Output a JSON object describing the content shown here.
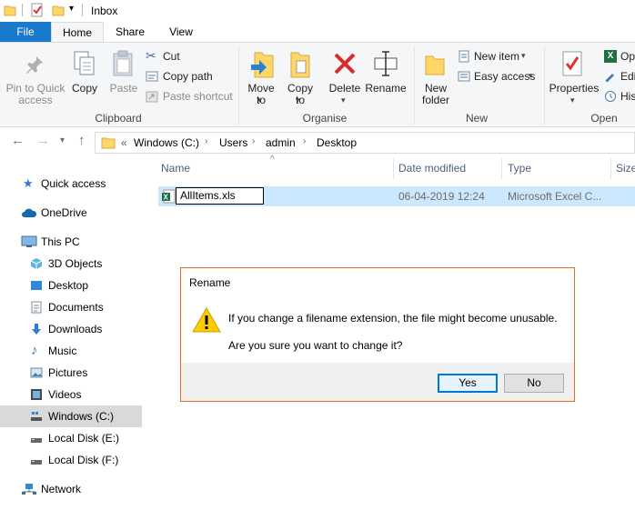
{
  "window": {
    "title": "Inbox"
  },
  "ribbon_tabs": [
    "File",
    "Home",
    "Share",
    "View"
  ],
  "clipboard": {
    "pin": "Pin to Quick access",
    "copy": "Copy",
    "paste": "Paste",
    "cut": "Cut",
    "copy_path": "Copy path",
    "paste_shortcut": "Paste shortcut",
    "group": "Clipboard"
  },
  "organise": {
    "move_to": "Move to",
    "copy_to": "Copy to",
    "delete": "Delete",
    "rename": "Rename",
    "group": "Organise"
  },
  "new_group": {
    "new_folder": "New folder",
    "new_item": "New item",
    "easy_access": "Easy access",
    "group": "New"
  },
  "open_group": {
    "properties": "Properties",
    "open": "Op",
    "edit": "Edi",
    "history": "His",
    "group": "Open"
  },
  "address": {
    "overflow": "«",
    "crumbs": [
      "Windows (C:)",
      "Users",
      "admin",
      "Desktop"
    ]
  },
  "sidebar": {
    "items": [
      {
        "label": "Quick access",
        "icon": "star-icon"
      },
      {
        "label": "OneDrive",
        "icon": "cloud-icon"
      },
      {
        "label": "This PC",
        "icon": "computer-icon"
      },
      {
        "label": "3D Objects",
        "icon": "cube-icon"
      },
      {
        "label": "Desktop",
        "icon": "desktop-icon"
      },
      {
        "label": "Documents",
        "icon": "documents-icon"
      },
      {
        "label": "Downloads",
        "icon": "download-icon"
      },
      {
        "label": "Music",
        "icon": "music-icon"
      },
      {
        "label": "Pictures",
        "icon": "pictures-icon"
      },
      {
        "label": "Videos",
        "icon": "videos-icon"
      },
      {
        "label": "Windows (C:)",
        "icon": "drive-icon"
      },
      {
        "label": "Local Disk (E:)",
        "icon": "disk-icon"
      },
      {
        "label": "Local Disk (F:)",
        "icon": "disk-icon"
      },
      {
        "label": "Network",
        "icon": "network-icon"
      }
    ]
  },
  "columns": [
    "Name",
    "Date modified",
    "Type",
    "Size"
  ],
  "files": [
    {
      "name": "AllItems.xls",
      "date": "06-04-2019 12:24",
      "type": "Microsoft Excel C..."
    }
  ],
  "dialog": {
    "title": "Rename",
    "message": "If you change a filename extension, the file might become unusable.",
    "question": "Are you sure you want to change it?",
    "yes": "Yes",
    "no": "No"
  },
  "colors": {
    "accent": "#1979ca",
    "selection": "#cce8ff",
    "dialog_border": "#e86a25"
  }
}
